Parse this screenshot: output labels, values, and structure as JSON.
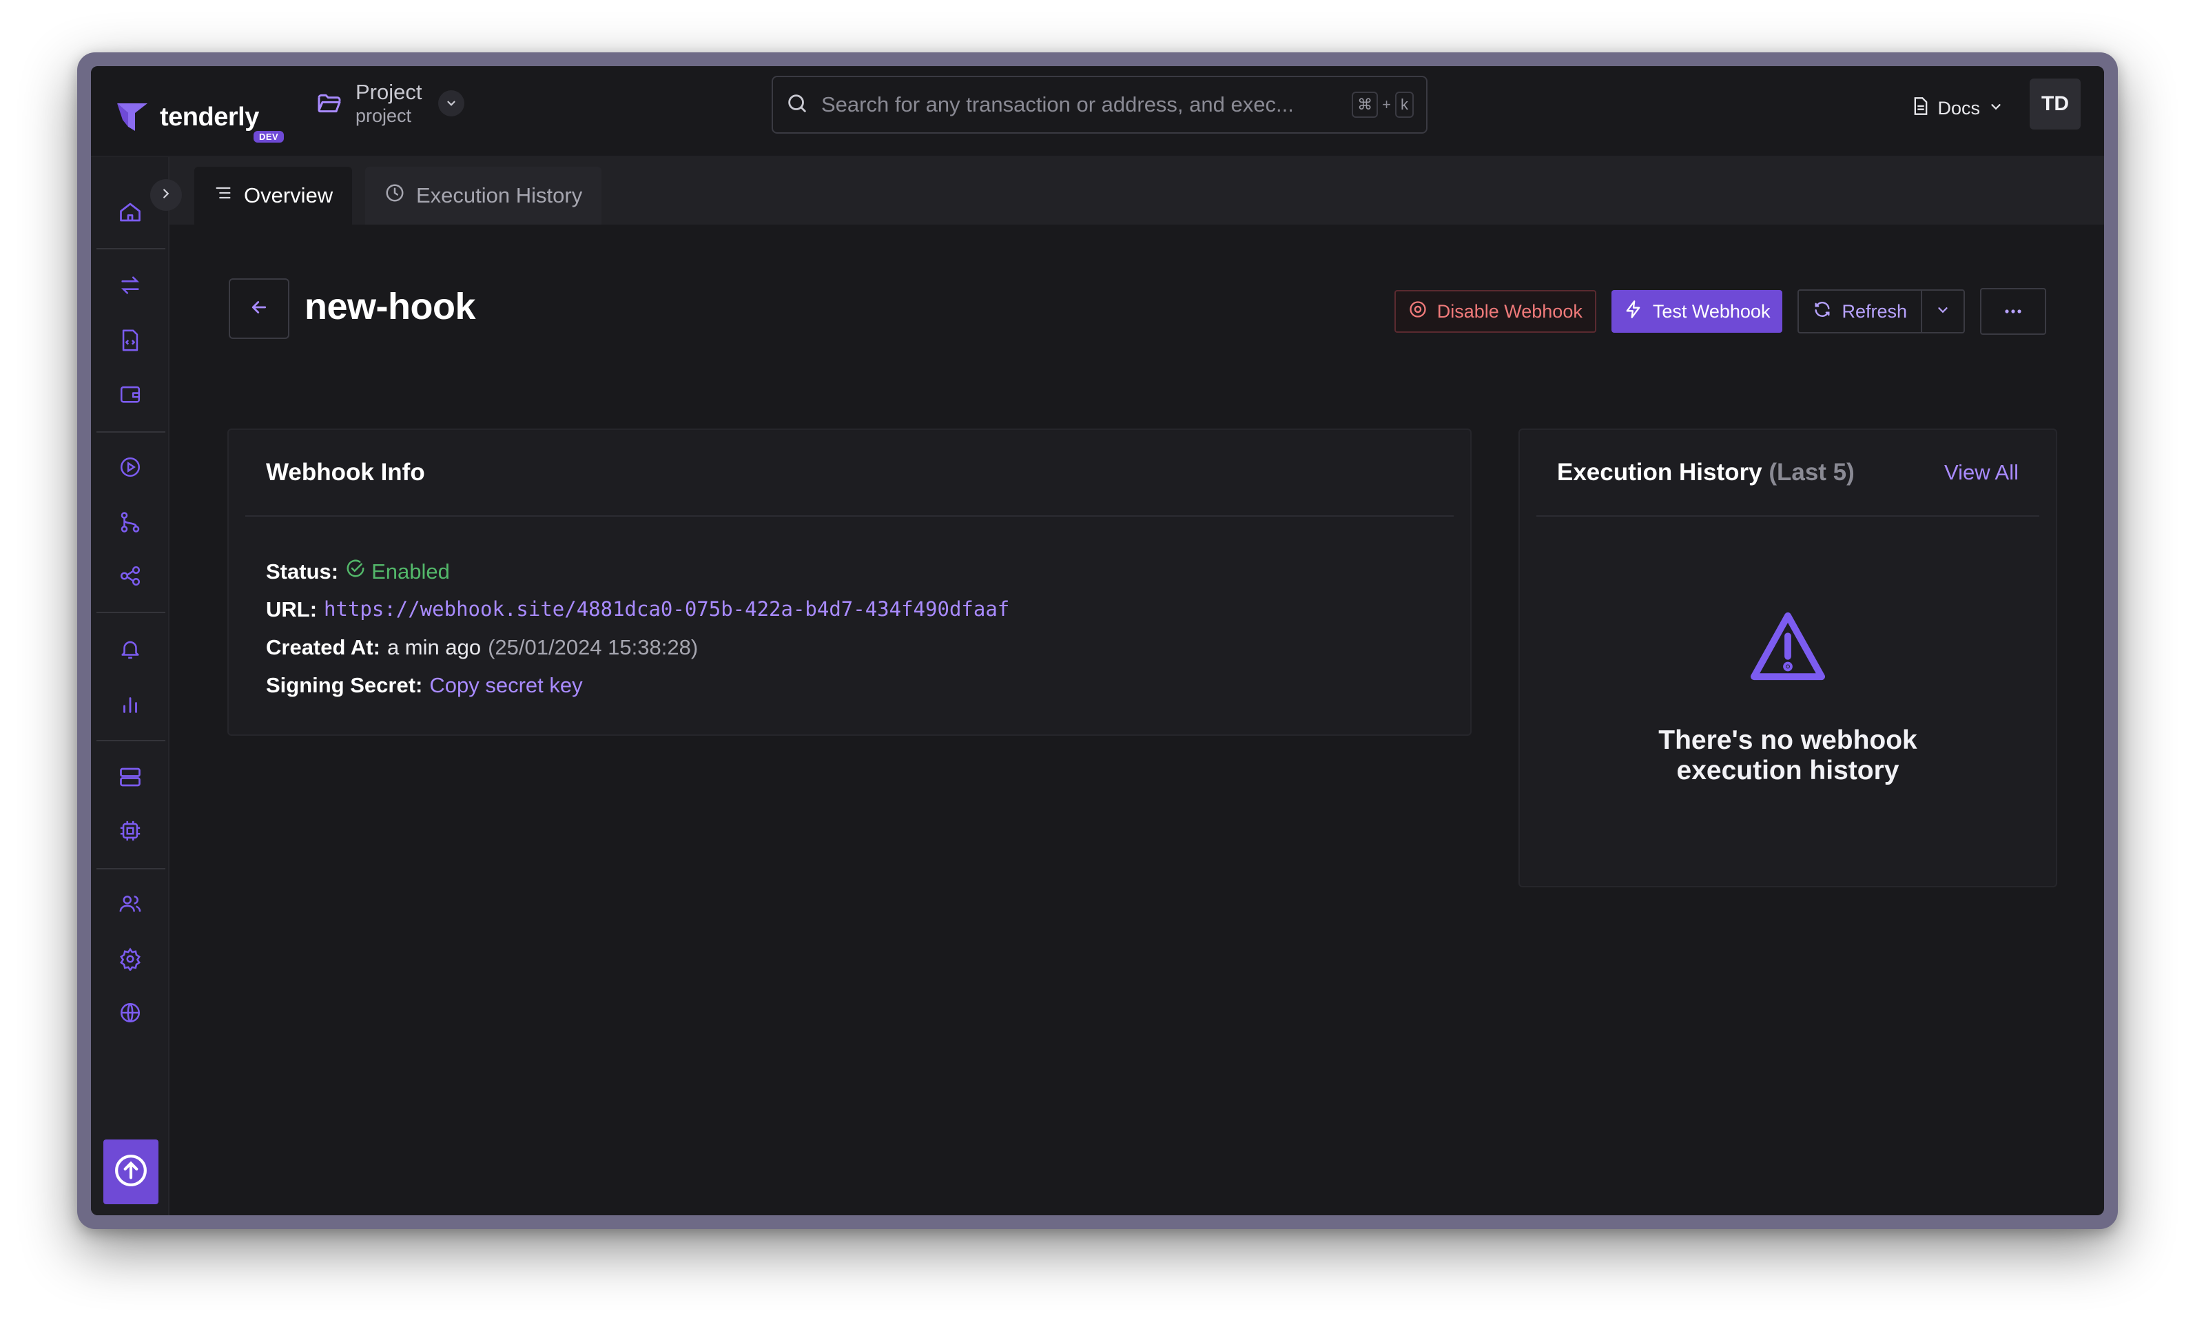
{
  "brand": {
    "name": "tenderly",
    "badge": "DEV",
    "accent": "#6f4ad6"
  },
  "project": {
    "name": "Project",
    "slug": "project"
  },
  "search": {
    "placeholder": "Search for any transaction or address, and exec...",
    "shortcut_mod": "⌘",
    "shortcut_plus": "+",
    "shortcut_key": "k"
  },
  "header": {
    "docs_label": "Docs",
    "avatar_initials": "TD"
  },
  "sidebar": {
    "icons": [
      "home-icon",
      "transactions-icon",
      "contracts-icon",
      "wallet-icon",
      "simulator-icon",
      "forks-icon",
      "web3-actions-icon",
      "alerts-icon",
      "analytics-icon",
      "nodes-icon",
      "devnets-icon",
      "users-icon",
      "settings-icon",
      "networks-icon",
      "upload-icon"
    ]
  },
  "tabs": [
    {
      "label": "Overview",
      "active": true
    },
    {
      "label": "Execution History",
      "active": false
    }
  ],
  "page": {
    "title": "new-hook"
  },
  "actions": {
    "disable_label": "Disable Webhook",
    "test_label": "Test Webhook",
    "refresh_label": "Refresh"
  },
  "webhook_info": {
    "title": "Webhook Info",
    "status_label": "Status:",
    "status_value": "Enabled",
    "url_label": "URL:",
    "url_value": "https://webhook.site/4881dca0-075b-422a-b4d7-434f490dfaaf",
    "created_label": "Created At:",
    "created_relative": "a min ago",
    "created_date": "(25/01/2024 15:38:28)",
    "secret_label": "Signing Secret:",
    "secret_action": "Copy secret key"
  },
  "execution_history": {
    "title": "Execution History",
    "subtitle": "(Last 5)",
    "view_all": "View All",
    "empty_message": "There's no webhook execution history"
  }
}
